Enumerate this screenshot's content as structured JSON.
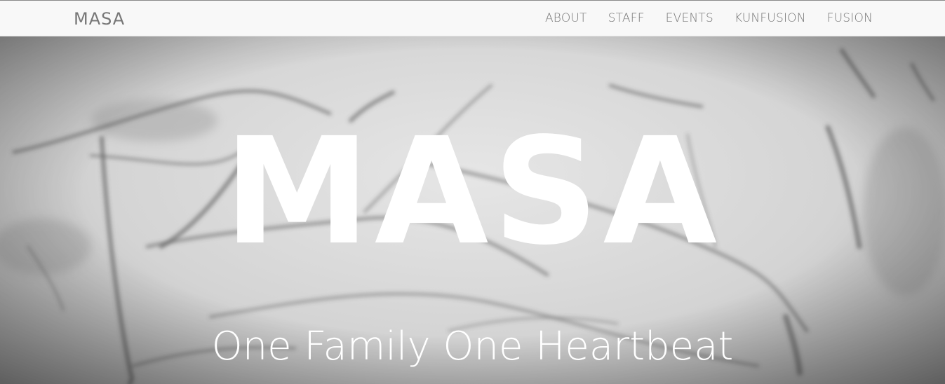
{
  "navbar": {
    "brand": "MASA",
    "links": [
      {
        "label": "ABOUT"
      },
      {
        "label": "STAFF"
      },
      {
        "label": "EVENTS"
      },
      {
        "label": "KUNFUSION"
      },
      {
        "label": "FUSION"
      }
    ]
  },
  "hero": {
    "title": "MASA",
    "subtitle": "One Family One Heartbeat"
  },
  "colors": {
    "navbar_bg": "#f8f8f8",
    "nav_text": "#777777",
    "hero_text": "#ffffff"
  }
}
